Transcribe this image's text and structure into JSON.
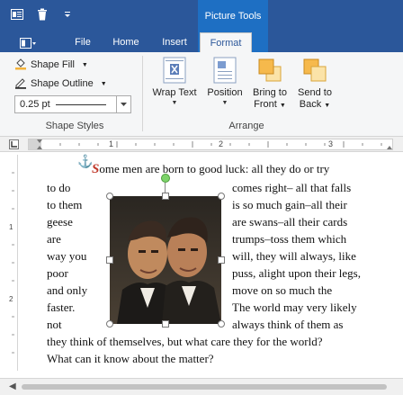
{
  "titlebar": {
    "context_title": "Picture Tools",
    "quick_access": [
      "app-menu",
      "delete",
      "customize"
    ]
  },
  "tabs": {
    "file": "",
    "items": [
      {
        "label": "File"
      },
      {
        "label": "Home"
      },
      {
        "label": "Insert"
      },
      {
        "label": "Format"
      }
    ],
    "active": "Format"
  },
  "ribbon": {
    "shape_styles": {
      "shape_fill": "Shape Fill",
      "shape_outline": "Shape Outline",
      "line_weight_value": "0.25 pt",
      "group_label": "Shape Styles"
    },
    "arrange": {
      "wrap_text": "Wrap Text",
      "position": "Position",
      "bring_to_front_1": "Bring to",
      "bring_to_front_2": "Front",
      "send_to_back_1": "Send to",
      "send_to_back_2": "Back",
      "group_label": "Arrange"
    }
  },
  "ruler": {
    "marks": [
      "1",
      "2",
      "3"
    ],
    "vmarks": [
      "1",
      "2"
    ]
  },
  "document": {
    "first_line_rest": "ome men are born to good luck: all they do or try",
    "dropcap": "S",
    "left_col": [
      "to do",
      "to them",
      "geese",
      "are",
      "way you",
      "poor",
      "and only",
      "faster.",
      "not"
    ],
    "right_col": [
      "comes right– all that falls",
      "is so much gain–all their",
      "are swans–all their cards",
      "trumps–toss them which",
      "will, they will always, like",
      "puss, alight upon their legs,",
      "move on so much the",
      "The world may very likely",
      "always think of them as"
    ],
    "last_lines": [
      "they think of themselves, but what care they for the world?",
      "What can it know about the matter?"
    ]
  },
  "colors": {
    "title_blue": "#2b579a",
    "context_blue": "#1e6fc3",
    "dropcap_red": "#c0392b",
    "rotate_handle_green": "#7dd36a"
  }
}
